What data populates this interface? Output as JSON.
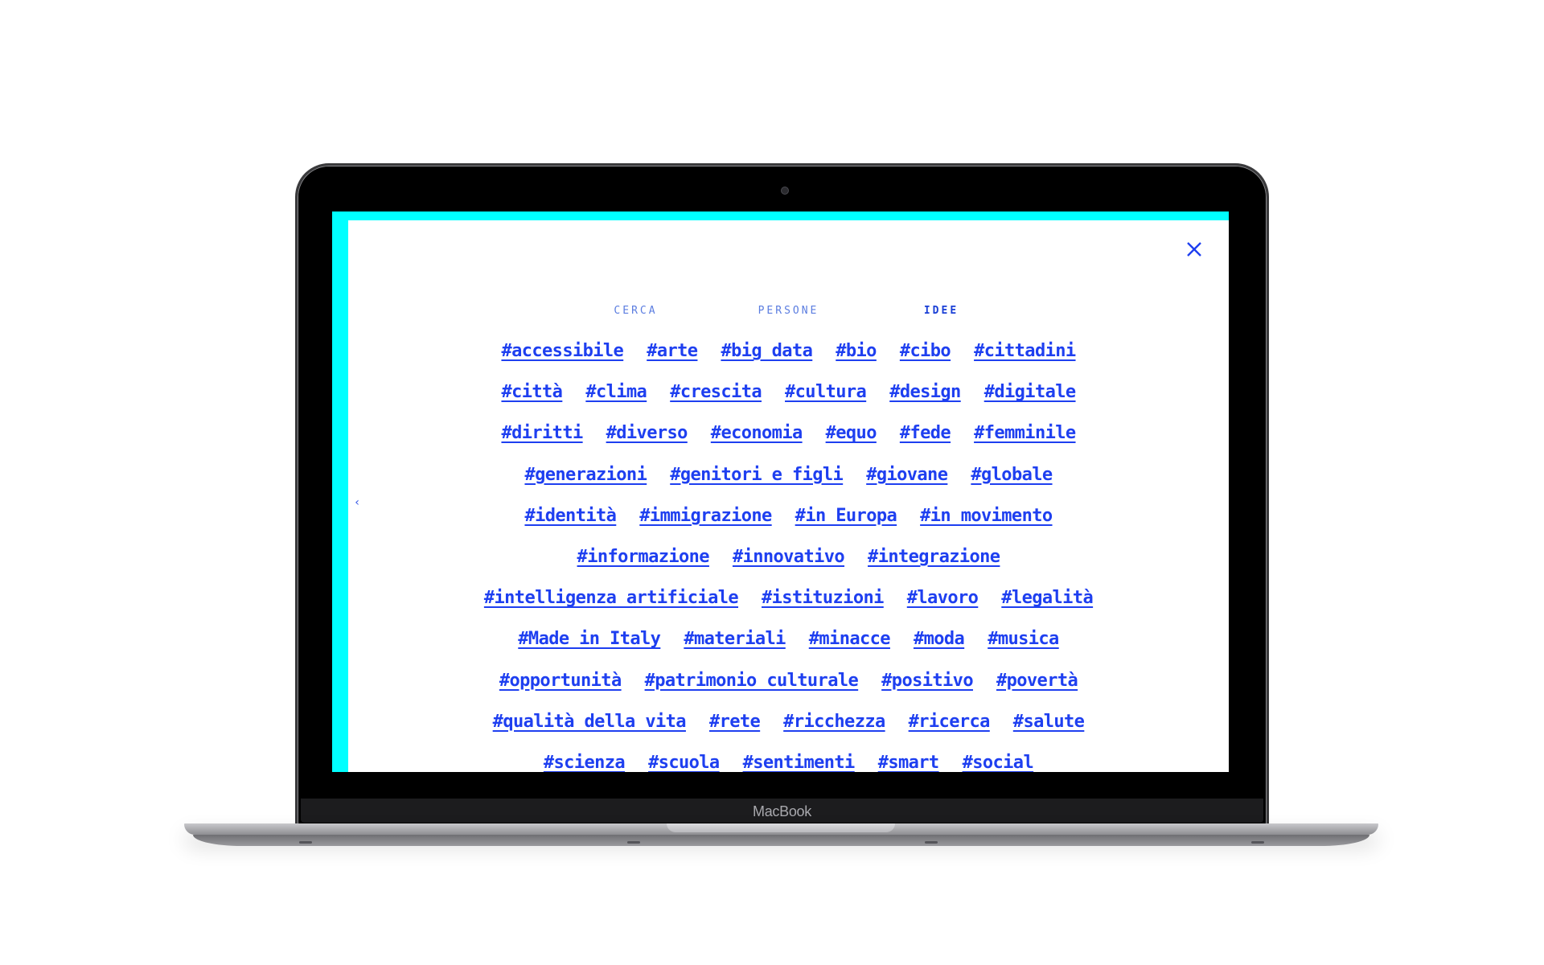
{
  "device": {
    "brand_label": "MacBook"
  },
  "colors": {
    "accent_cyan": "#00ffff",
    "link_blue": "#1e3ff0",
    "tab_blue": "#5b7de0"
  },
  "page": {
    "back_icon": "chevron-left-icon",
    "close_icon": "close-icon",
    "tabs": [
      {
        "label": "CERCA",
        "active": false
      },
      {
        "label": "PERSONE",
        "active": false
      },
      {
        "label": "IDEE",
        "active": true
      }
    ],
    "tag_rows": [
      [
        "#accessibile",
        "#arte",
        "#big data",
        "#bio",
        "#cibo",
        "#cittadini"
      ],
      [
        "#città",
        "#clima",
        "#crescita",
        "#cultura",
        "#design",
        "#digitale"
      ],
      [
        "#diritti",
        "#diverso",
        "#economia",
        "#equo",
        "#fede",
        "#femminile"
      ],
      [
        "#generazioni",
        "#genitori e figli",
        "#giovane",
        "#globale"
      ],
      [
        "#identità",
        "#immigrazione",
        "#in Europa",
        "#in movimento"
      ],
      [
        "#informazione",
        "#innovativo",
        "#integrazione"
      ],
      [
        "#intelligenza artificiale",
        "#istituzioni",
        "#lavoro",
        "#legalità"
      ],
      [
        "#Made in Italy",
        "#materiali",
        "#minacce",
        "#moda",
        "#musica"
      ],
      [
        "#opportunità",
        "#patrimonio culturale",
        "#positivo",
        "#povertà"
      ],
      [
        "#qualità della vita",
        "#rete",
        "#ricchezza",
        "#ricerca",
        "#salute"
      ],
      [
        "#scienza",
        "#scuola",
        "#sentimenti",
        "#smart",
        "#social"
      ]
    ]
  }
}
